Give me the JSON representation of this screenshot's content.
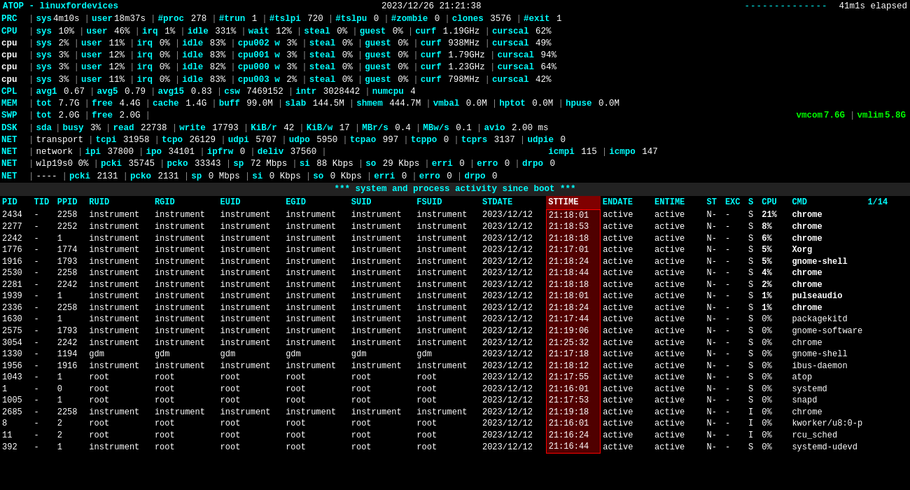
{
  "header": {
    "title": "ATOP - linuxfordevices",
    "datetime": "2023/12/26  21:21:38",
    "dashes": "--------------",
    "elapsed": "41m1s elapsed"
  },
  "stat_rows": [
    {
      "label": "PRC",
      "items": [
        {
          "key": "sys",
          "val": "4m10s"
        },
        {
          "key": "user",
          "val": "18m37s"
        },
        {
          "key": "#proc",
          "val": "278"
        },
        {
          "key": "#trun",
          "val": "1"
        },
        {
          "key": "#tslpi",
          "val": "720"
        },
        {
          "key": "#tslpu",
          "val": "0"
        },
        {
          "key": "#zombie",
          "val": "0"
        },
        {
          "key": "clones",
          "val": "3576"
        },
        {
          "key": "#exit",
          "val": "1"
        }
      ]
    },
    {
      "label": "CPU",
      "items": [
        {
          "key": "sys",
          "val": "10%"
        },
        {
          "key": "user",
          "val": "46%"
        },
        {
          "key": "irq",
          "val": "1%"
        },
        {
          "key": "idle",
          "val": "331%"
        },
        {
          "key": "wait",
          "val": "12%"
        },
        {
          "key": "steal",
          "val": "0%"
        },
        {
          "key": "guest",
          "val": "0%"
        },
        {
          "key": "curf",
          "val": "1.19GHz"
        },
        {
          "key": "curscal",
          "val": "62%"
        }
      ]
    },
    {
      "label": "cpu",
      "num": 0,
      "items": [
        {
          "key": "sys",
          "val": "2%"
        },
        {
          "key": "user",
          "val": "11%"
        },
        {
          "key": "irq",
          "val": "0%"
        },
        {
          "key": "idle",
          "val": "83%"
        },
        {
          "key": "cpu002 w",
          "val": "3%"
        },
        {
          "key": "steal",
          "val": "0%"
        },
        {
          "key": "guest",
          "val": "0%"
        },
        {
          "key": "curf",
          "val": "938MHz"
        },
        {
          "key": "curscal",
          "val": "49%"
        }
      ]
    },
    {
      "label": "cpu",
      "num": 1,
      "items": [
        {
          "key": "sys",
          "val": "3%"
        },
        {
          "key": "user",
          "val": "12%"
        },
        {
          "key": "irq",
          "val": "0%"
        },
        {
          "key": "idle",
          "val": "83%"
        },
        {
          "key": "cpu001 w",
          "val": "3%"
        },
        {
          "key": "steal",
          "val": "0%"
        },
        {
          "key": "guest",
          "val": "0%"
        },
        {
          "key": "curf",
          "val": "1.79GHz"
        },
        {
          "key": "curscal",
          "val": "94%"
        }
      ]
    },
    {
      "label": "cpu",
      "num": 2,
      "items": [
        {
          "key": "sys",
          "val": "3%"
        },
        {
          "key": "user",
          "val": "12%"
        },
        {
          "key": "irq",
          "val": "0%"
        },
        {
          "key": "idle",
          "val": "82%"
        },
        {
          "key": "cpu000 w",
          "val": "3%"
        },
        {
          "key": "steal",
          "val": "0%"
        },
        {
          "key": "guest",
          "val": "0%"
        },
        {
          "key": "curf",
          "val": "1.23GHz"
        },
        {
          "key": "curscal",
          "val": "64%"
        }
      ]
    },
    {
      "label": "cpu",
      "num": 3,
      "items": [
        {
          "key": "sys",
          "val": "3%"
        },
        {
          "key": "user",
          "val": "11%"
        },
        {
          "key": "irq",
          "val": "0%"
        },
        {
          "key": "idle",
          "val": "83%"
        },
        {
          "key": "cpu003 w",
          "val": "2%"
        },
        {
          "key": "steal",
          "val": "0%"
        },
        {
          "key": "guest",
          "val": "0%"
        },
        {
          "key": "curf",
          "val": "798MHz"
        },
        {
          "key": "curscal",
          "val": "42%"
        }
      ]
    },
    {
      "label": "CPL",
      "items": [
        {
          "key": "avg1",
          "val": "0.67"
        },
        {
          "key": "avg5",
          "val": "0.79"
        },
        {
          "key": "avg15",
          "val": "0.83"
        },
        {
          "key": "csw",
          "val": "7469152"
        },
        {
          "key": "intr",
          "val": "3028442"
        },
        {
          "key": "numcpu",
          "val": "4"
        }
      ]
    },
    {
      "label": "MEM",
      "items": [
        {
          "key": "tot",
          "val": "7.7G"
        },
        {
          "key": "free",
          "val": "4.4G"
        },
        {
          "key": "cache",
          "val": "1.4G"
        },
        {
          "key": "buff",
          "val": "99.0M"
        },
        {
          "key": "slab",
          "val": "144.5M"
        },
        {
          "key": "shmem",
          "val": "444.7M"
        },
        {
          "key": "vmbal",
          "val": "0.0M"
        },
        {
          "key": "hptot",
          "val": "0.0M"
        },
        {
          "key": "hpuse",
          "val": "0.0M"
        }
      ]
    },
    {
      "label": "SWP",
      "items": [
        {
          "key": "tot",
          "val": "2.0G"
        },
        {
          "key": "free",
          "val": "2.0G"
        },
        {
          "key": "vmcom",
          "val": "7.6G",
          "special": "green"
        },
        {
          "key": "vmlim",
          "val": "5.8G",
          "special": "green"
        }
      ]
    },
    {
      "label": "DSK",
      "items": [
        {
          "key": "sda",
          "val": ""
        },
        {
          "key": "busy",
          "val": "3%"
        },
        {
          "key": "read",
          "val": "22738"
        },
        {
          "key": "write",
          "val": "17793"
        },
        {
          "key": "KiB/r",
          "val": "42"
        },
        {
          "key": "KiB/w",
          "val": "17"
        },
        {
          "key": "MBr/s",
          "val": "0.4"
        },
        {
          "key": "MBw/s",
          "val": "0.1"
        },
        {
          "key": "avio",
          "val": "2.00 ms"
        }
      ]
    },
    {
      "label": "NET",
      "sub": "transport",
      "items": [
        {
          "key": "tcpi",
          "val": "31958"
        },
        {
          "key": "tcpo",
          "val": "26129"
        },
        {
          "key": "udpi",
          "val": "5707"
        },
        {
          "key": "udpo",
          "val": "5950"
        },
        {
          "key": "tcpao",
          "val": "997"
        },
        {
          "key": "tcppo",
          "val": "0"
        },
        {
          "key": "tcprs",
          "val": "3137"
        },
        {
          "key": "udpie",
          "val": "0"
        }
      ]
    },
    {
      "label": "NET",
      "sub": "network",
      "items": [
        {
          "key": "ipi",
          "val": "37800"
        },
        {
          "key": "ipo",
          "val": "34101"
        },
        {
          "key": "ipfrw",
          "val": "0"
        },
        {
          "key": "deliv",
          "val": "37560"
        },
        {
          "key": "icmpi",
          "val": "115"
        },
        {
          "key": "icmpo",
          "val": "147"
        }
      ]
    },
    {
      "label": "NET",
      "sub": "wlp19s0 0%",
      "items": [
        {
          "key": "pcki",
          "val": "35745"
        },
        {
          "key": "pcko",
          "val": "33343"
        },
        {
          "key": "sp",
          "val": "72 Mbps"
        },
        {
          "key": "si",
          "val": "88 Kbps"
        },
        {
          "key": "so",
          "val": "29 Kbps"
        },
        {
          "key": "erri",
          "val": "0"
        },
        {
          "key": "erro",
          "val": "0"
        },
        {
          "key": "drpo",
          "val": "0"
        }
      ]
    },
    {
      "label": "NET",
      "sub": "----",
      "items": [
        {
          "key": "pcki",
          "val": "2131"
        },
        {
          "key": "pcko",
          "val": "2131"
        },
        {
          "key": "sp",
          "val": "0 Mbps"
        },
        {
          "key": "si",
          "val": "0 Kbps"
        },
        {
          "key": "so",
          "val": "0 Kbps"
        },
        {
          "key": "erri",
          "val": "0"
        },
        {
          "key": "erro",
          "val": "0"
        },
        {
          "key": "drpo",
          "val": "0"
        }
      ]
    }
  ],
  "divider": "*** system and process activity since boot ***",
  "table_header": {
    "columns": [
      "PID",
      "TID",
      "PPID",
      "RUID",
      "RGID",
      "EUID",
      "EGID",
      "SUID",
      "FSUID",
      "STDATE",
      "STTIME",
      "ENDATE",
      "ENTIME",
      "ST",
      "EXC",
      "S",
      "CPU",
      "CMD"
    ],
    "page_label": "1/14"
  },
  "processes": [
    {
      "pid": "2434",
      "tid": "-",
      "ppid": "2258",
      "ruid": "instrument",
      "rgid": "instrument",
      "euid": "instrument",
      "egid": "instrument",
      "suid": "instrument",
      "fsuid": "instrument",
      "stdate": "2023/12/12",
      "sttime": "21:18:01",
      "endate": "active",
      "entime": "active",
      "st": "N-",
      "exc": "-",
      "s": "S",
      "cpu": "21%",
      "cmd": "chrome"
    },
    {
      "pid": "2277",
      "tid": "-",
      "ppid": "2252",
      "ruid": "instrument",
      "rgid": "instrument",
      "euid": "instrument",
      "egid": "instrument",
      "suid": "instrument",
      "fsuid": "instrument",
      "stdate": "2023/12/12",
      "sttime": "21:18:53",
      "endate": "active",
      "entime": "active",
      "st": "N-",
      "exc": "-",
      "s": "S",
      "cpu": "8%",
      "cmd": "chrome"
    },
    {
      "pid": "2242",
      "tid": "-",
      "ppid": "1",
      "ruid": "instrument",
      "rgid": "instrument",
      "euid": "instrument",
      "egid": "instrument",
      "suid": "instrument",
      "fsuid": "instrument",
      "stdate": "2023/12/12",
      "sttime": "21:18:18",
      "endate": "active",
      "entime": "active",
      "st": "N-",
      "exc": "-",
      "s": "S",
      "cpu": "6%",
      "cmd": "chrome"
    },
    {
      "pid": "1776",
      "tid": "-",
      "ppid": "1774",
      "ruid": "instrument",
      "rgid": "instrument",
      "euid": "instrument",
      "egid": "instrument",
      "suid": "instrument",
      "fsuid": "instrument",
      "stdate": "2023/12/12",
      "sttime": "21:17:01",
      "endate": "active",
      "entime": "active",
      "st": "N-",
      "exc": "-",
      "s": "S",
      "cpu": "5%",
      "cmd": "Xorg"
    },
    {
      "pid": "1916",
      "tid": "-",
      "ppid": "1793",
      "ruid": "instrument",
      "rgid": "instrument",
      "euid": "instrument",
      "egid": "instrument",
      "suid": "instrument",
      "fsuid": "instrument",
      "stdate": "2023/12/12",
      "sttime": "21:18:24",
      "endate": "active",
      "entime": "active",
      "st": "N-",
      "exc": "-",
      "s": "S",
      "cpu": "5%",
      "cmd": "gnome-shell"
    },
    {
      "pid": "2530",
      "tid": "-",
      "ppid": "2258",
      "ruid": "instrument",
      "rgid": "instrument",
      "euid": "instrument",
      "egid": "instrument",
      "suid": "instrument",
      "fsuid": "instrument",
      "stdate": "2023/12/12",
      "sttime": "21:18:44",
      "endate": "active",
      "entime": "active",
      "st": "N-",
      "exc": "-",
      "s": "S",
      "cpu": "4%",
      "cmd": "chrome"
    },
    {
      "pid": "2281",
      "tid": "-",
      "ppid": "2242",
      "ruid": "instrument",
      "rgid": "instrument",
      "euid": "instrument",
      "egid": "instrument",
      "suid": "instrument",
      "fsuid": "instrument",
      "stdate": "2023/12/12",
      "sttime": "21:18:18",
      "endate": "active",
      "entime": "active",
      "st": "N-",
      "exc": "-",
      "s": "S",
      "cpu": "2%",
      "cmd": "chrome"
    },
    {
      "pid": "1939",
      "tid": "-",
      "ppid": "1",
      "ruid": "instrument",
      "rgid": "instrument",
      "euid": "instrument",
      "egid": "instrument",
      "suid": "instrument",
      "fsuid": "instrument",
      "stdate": "2023/12/12",
      "sttime": "21:18:01",
      "endate": "active",
      "entime": "active",
      "st": "N-",
      "exc": "-",
      "s": "S",
      "cpu": "1%",
      "cmd": "pulseaudio"
    },
    {
      "pid": "2336",
      "tid": "-",
      "ppid": "2258",
      "ruid": "instrument",
      "rgid": "instrument",
      "euid": "instrument",
      "egid": "instrument",
      "suid": "instrument",
      "fsuid": "instrument",
      "stdate": "2023/12/12",
      "sttime": "21:18:24",
      "endate": "active",
      "entime": "active",
      "st": "N-",
      "exc": "-",
      "s": "S",
      "cpu": "1%",
      "cmd": "chrome"
    },
    {
      "pid": "1630",
      "tid": "-",
      "ppid": "1",
      "ruid": "instrument",
      "rgid": "instrument",
      "euid": "instrument",
      "egid": "instrument",
      "suid": "instrument",
      "fsuid": "instrument",
      "stdate": "2023/12/12",
      "sttime": "21:17:44",
      "endate": "active",
      "entime": "active",
      "st": "N-",
      "exc": "-",
      "s": "S",
      "cpu": "0%",
      "cmd": "packagekitd"
    },
    {
      "pid": "2575",
      "tid": "-",
      "ppid": "1793",
      "ruid": "instrument",
      "rgid": "instrument",
      "euid": "instrument",
      "egid": "instrument",
      "suid": "instrument",
      "fsuid": "instrument",
      "stdate": "2023/12/12",
      "sttime": "21:19:06",
      "endate": "active",
      "entime": "active",
      "st": "N-",
      "exc": "-",
      "s": "S",
      "cpu": "0%",
      "cmd": "gnome-software"
    },
    {
      "pid": "3054",
      "tid": "-",
      "ppid": "2242",
      "ruid": "instrument",
      "rgid": "instrument",
      "euid": "instrument",
      "egid": "instrument",
      "suid": "instrument",
      "fsuid": "instrument",
      "stdate": "2023/12/12",
      "sttime": "21:25:32",
      "endate": "active",
      "entime": "active",
      "st": "N-",
      "exc": "-",
      "s": "S",
      "cpu": "0%",
      "cmd": "chrome"
    },
    {
      "pid": "1330",
      "tid": "-",
      "ppid": "1194",
      "ruid": "gdm",
      "rgid": "gdm",
      "euid": "gdm",
      "egid": "gdm",
      "suid": "gdm",
      "fsuid": "gdm",
      "stdate": "2023/12/12",
      "sttime": "21:17:18",
      "endate": "active",
      "entime": "active",
      "st": "N-",
      "exc": "-",
      "s": "S",
      "cpu": "0%",
      "cmd": "gnome-shell"
    },
    {
      "pid": "1956",
      "tid": "-",
      "ppid": "1916",
      "ruid": "instrument",
      "rgid": "instrument",
      "euid": "instrument",
      "egid": "instrument",
      "suid": "instrument",
      "fsuid": "instrument",
      "stdate": "2023/12/12",
      "sttime": "21:18:12",
      "endate": "active",
      "entime": "active",
      "st": "N-",
      "exc": "-",
      "s": "S",
      "cpu": "0%",
      "cmd": "ibus-daemon"
    },
    {
      "pid": "1043",
      "tid": "-",
      "ppid": "1",
      "ruid": "root",
      "rgid": "root",
      "euid": "root",
      "egid": "root",
      "suid": "root",
      "fsuid": "root",
      "stdate": "2023/12/12",
      "sttime": "21:17:55",
      "endate": "active",
      "entime": "active",
      "st": "N-",
      "exc": "-",
      "s": "S",
      "cpu": "0%",
      "cmd": "atop"
    },
    {
      "pid": "1",
      "tid": "-",
      "ppid": "0",
      "ruid": "root",
      "rgid": "root",
      "euid": "root",
      "egid": "root",
      "suid": "root",
      "fsuid": "root",
      "stdate": "2023/12/12",
      "sttime": "21:16:01",
      "endate": "active",
      "entime": "active",
      "st": "N-",
      "exc": "-",
      "s": "S",
      "cpu": "0%",
      "cmd": "systemd"
    },
    {
      "pid": "1005",
      "tid": "-",
      "ppid": "1",
      "ruid": "root",
      "rgid": "root",
      "euid": "root",
      "egid": "root",
      "suid": "root",
      "fsuid": "root",
      "stdate": "2023/12/12",
      "sttime": "21:17:53",
      "endate": "active",
      "entime": "active",
      "st": "N-",
      "exc": "-",
      "s": "S",
      "cpu": "0%",
      "cmd": "snapd"
    },
    {
      "pid": "2685",
      "tid": "-",
      "ppid": "2258",
      "ruid": "instrument",
      "rgid": "instrument",
      "euid": "instrument",
      "egid": "instrument",
      "suid": "instrument",
      "fsuid": "instrument",
      "stdate": "2023/12/12",
      "sttime": "21:19:18",
      "endate": "active",
      "entime": "active",
      "st": "N-",
      "exc": "-",
      "s": "I",
      "cpu": "0%",
      "cmd": "chrome"
    },
    {
      "pid": "8",
      "tid": "-",
      "ppid": "2",
      "ruid": "root",
      "rgid": "root",
      "euid": "root",
      "egid": "root",
      "suid": "root",
      "fsuid": "root",
      "stdate": "2023/12/12",
      "sttime": "21:16:01",
      "endate": "active",
      "entime": "active",
      "st": "N-",
      "exc": "-",
      "s": "I",
      "cpu": "0%",
      "cmd": "kworker/u8:0-p"
    },
    {
      "pid": "11",
      "tid": "-",
      "ppid": "2",
      "ruid": "root",
      "rgid": "root",
      "euid": "root",
      "egid": "root",
      "suid": "root",
      "fsuid": "root",
      "stdate": "2023/12/12",
      "sttime": "21:16:24",
      "endate": "active",
      "entime": "active",
      "st": "N-",
      "exc": "-",
      "s": "I",
      "cpu": "0%",
      "cmd": "rcu_sched"
    },
    {
      "pid": "392",
      "tid": "-",
      "ppid": "1",
      "ruid": "instrument",
      "rgid": "root",
      "euid": "root",
      "egid": "root",
      "suid": "root",
      "fsuid": "root",
      "stdate": "2023/12/12",
      "sttime": "21:16:44",
      "endate": "active",
      "entime": "active",
      "st": "N-",
      "exc": "-",
      "s": "S",
      "cpu": "0%",
      "cmd": "systemd-udevd"
    }
  ]
}
